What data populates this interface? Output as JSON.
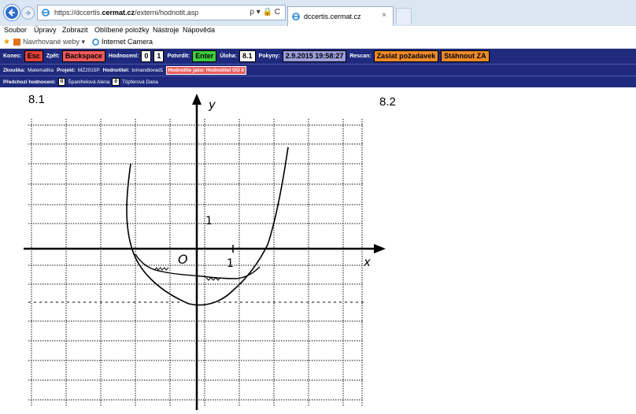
{
  "browser": {
    "address_url_prefix": "https://dccertis.",
    "address_url_domain": "cermat.cz",
    "address_url_path": "/externi/hodnotit.asp",
    "address_controls": "ρ ▾ 🔒 C",
    "tab_title": "dccertis.cermat.cz",
    "tab_close": "×",
    "menu": [
      "Soubor",
      "Úpravy",
      "Zobrazit",
      "Oblíbené položky",
      "Nástroje",
      "Nápověda"
    ],
    "favorites": {
      "item1": "Navrhované weby ▾",
      "item2": "Internet Camera"
    }
  },
  "app_bar": {
    "konec_label": "Konec:",
    "konec_key": "Esc",
    "zpet_label": "Zpět:",
    "zpet_key": "Backspace",
    "hodnoceni_label": "Hodnocení:",
    "score_options": [
      "0",
      "1"
    ],
    "potvrdit_label": "Potvrdit:",
    "potvrdit_key": "Enter",
    "uloha_label": "Úloha:",
    "uloha_value": "8.1",
    "pokyny_label": "Pokyny:",
    "pokyny_value": "2.9.2015 19:58:27",
    "rescan_label": "Rescan:",
    "zaslat_button": "Zaslat požadavek",
    "stahnout_button": "Stáhnout ZA"
  },
  "info_bar": {
    "zkouska_label": "Zkouška:",
    "zkouska_value": "Matematika",
    "projekt_label": "Projekt:",
    "projekt_value": "MZ2015P",
    "hodnotitel_label": "Hodnotitel:",
    "hodnotitel_value": "tomandlovad1",
    "hodnotite_jako": "Hodnotíte jako: Hodnotitel OÚ II"
  },
  "prev_bar": {
    "label": "Předchozí hodnocení:",
    "entries": [
      {
        "score": "0",
        "name": "Španihelová Alena"
      },
      {
        "score": "0",
        "name": "Töpferová Dana"
      }
    ]
  },
  "scan": {
    "task_left": "8.1",
    "task_right": "8.2",
    "axis_y": "y",
    "axis_x": "x",
    "origin": "O",
    "tick_x": "1",
    "tick_y": "1"
  },
  "colors": {
    "app_bar_bg": "#1f2a7e",
    "esc_red": "#e0413a",
    "enter_green": "#3ecf3e",
    "pokyny_lavender": "#9b9bdb",
    "rescan_orange": "#f08a28",
    "browser_back_blue": "#2c6fcf"
  }
}
